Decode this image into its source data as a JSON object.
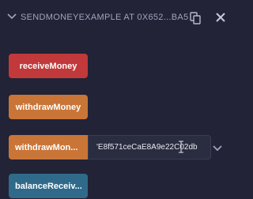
{
  "panel": {
    "title": "SENDMONEYEXAMPLE AT 0X652...BA5"
  },
  "buttons": {
    "receive_money": "receiveMoney",
    "withdraw_money": "withdrawMoney",
    "withdraw_money_to": "withdrawMon...",
    "balance_received": "balanceReceiv..."
  },
  "withdraw_to_input": {
    "value": "'E8f571ceCaE8A9e22C02db"
  },
  "colors": {
    "background": "#222336",
    "red": "#c1393b",
    "orange": "#c97538",
    "blue": "#2f6a8a"
  },
  "icons": {
    "collapse": "chevron-down-icon",
    "copy": "copy-icon",
    "close": "close-icon",
    "expand": "chevron-down-icon"
  }
}
